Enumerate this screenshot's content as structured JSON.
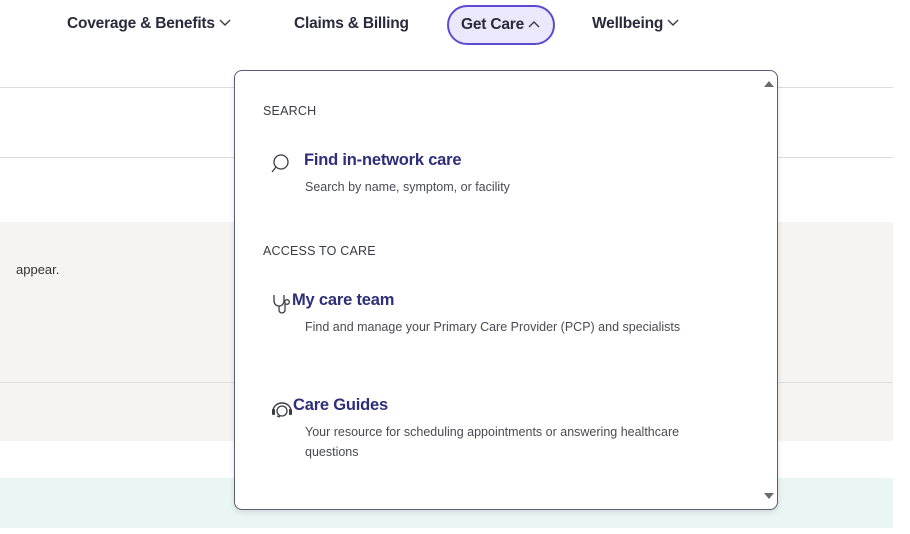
{
  "colors": {
    "accent": "#5b4bd0",
    "active_bg": "#ebe8fb",
    "link": "#2e2e7a",
    "band_gray": "#f5f4f2",
    "band_mint": "#eaf6f3"
  },
  "nav": {
    "items": [
      {
        "label": "Coverage & Benefits",
        "icon": "chevron-down-icon"
      },
      {
        "label": "Claims & Billing"
      },
      {
        "label": "Get Care",
        "icon": "chevron-up-icon",
        "active": true
      },
      {
        "label": "Wellbeing",
        "icon": "chevron-down-icon"
      }
    ]
  },
  "background": {
    "partial_text": "appear."
  },
  "dropdown": {
    "sections": [
      {
        "heading": "SEARCH",
        "items": [
          {
            "title": "Find in-network care",
            "description": "Search by name, symptom, or facility",
            "icon": "search-icon"
          }
        ]
      },
      {
        "heading": "ACCESS TO CARE",
        "items": [
          {
            "title": "My care team",
            "description": "Find and manage your Primary Care Provider (PCP) and specialists",
            "icon": "stethoscope-icon"
          },
          {
            "title": "Care Guides",
            "description": "Your resource for scheduling appointments or answering healthcare questions",
            "icon": "headset-icon"
          }
        ]
      }
    ]
  }
}
